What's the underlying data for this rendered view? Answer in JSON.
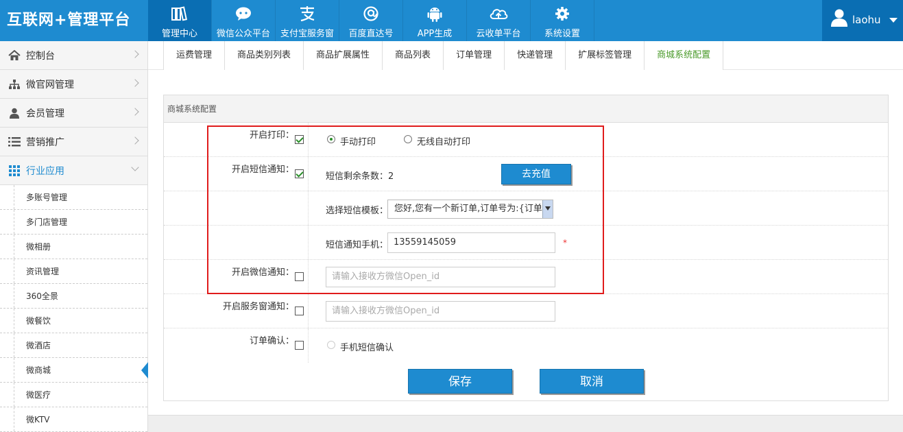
{
  "app": {
    "logo": "互联网+管理平台"
  },
  "topnav": [
    {
      "label": "管理中心",
      "icon": "books-icon",
      "active": true
    },
    {
      "label": "微信公众平台",
      "icon": "chat-bubble-icon",
      "active": false
    },
    {
      "label": "支付宝服务窗",
      "icon": "alipay-icon",
      "active": false
    },
    {
      "label": "百度直达号",
      "icon": "at-sign-icon",
      "active": false
    },
    {
      "label": "APP生成",
      "icon": "android-icon",
      "active": false
    },
    {
      "label": "云收单平台",
      "icon": "cloud-upload-icon",
      "active": false
    },
    {
      "label": "系统设置",
      "icon": "gear-icon",
      "active": false
    }
  ],
  "user": {
    "name": "laohu",
    "icon": "user-icon"
  },
  "sidebar": {
    "items": [
      {
        "label": "控制台",
        "icon": "home-icon"
      },
      {
        "label": "微官网管理",
        "icon": "sitemap-icon"
      },
      {
        "label": "会员管理",
        "icon": "user-icon"
      },
      {
        "label": "营销推广",
        "icon": "list-icon"
      },
      {
        "label": "行业应用",
        "icon": "grid-icon",
        "open": true
      }
    ],
    "subitems": [
      {
        "label": "多账号管理"
      },
      {
        "label": "多门店管理"
      },
      {
        "label": "微相册"
      },
      {
        "label": "资讯管理"
      },
      {
        "label": "360全景"
      },
      {
        "label": "微餐饮"
      },
      {
        "label": "微酒店"
      },
      {
        "label": "微商城",
        "active": true
      },
      {
        "label": "微医疗"
      },
      {
        "label": "微KTV"
      }
    ]
  },
  "subtabs": [
    {
      "label": "运费管理"
    },
    {
      "label": "商品类别列表"
    },
    {
      "label": "商品扩展属性"
    },
    {
      "label": "商品列表"
    },
    {
      "label": "订单管理"
    },
    {
      "label": "快递管理"
    },
    {
      "label": "扩展标签管理"
    },
    {
      "label": "商城系统配置",
      "active": true
    }
  ],
  "panel": {
    "title": "商城系统配置",
    "print": {
      "label": "开启打印：",
      "checked": true,
      "options": [
        "手动打印",
        "无线自动打印"
      ],
      "selected": "手动打印"
    },
    "sms": {
      "label": "开启短信通知：",
      "checked": true,
      "remaining_label": "短信剩余条数：2",
      "recharge_button": "去充值"
    },
    "sms_template": {
      "label": "选择短信模板：",
      "value": "您好,您有一个新订单,订单号为:{订单号}"
    },
    "sms_phone": {
      "label": "短信通知手机：",
      "value": "13559145059",
      "required_mark": "*"
    },
    "wechat": {
      "label": "开启微信通知：",
      "checked": false,
      "placeholder": "请输入接收方微信Open_id"
    },
    "service_window": {
      "label": "开启服务窗通知：",
      "checked": false,
      "placeholder": "请输入接收方微信Open_id"
    },
    "order_confirm": {
      "label": "订单确认：",
      "checked": false,
      "option": "手机短信确认"
    }
  },
  "actions": {
    "save": "保存",
    "cancel": "取消"
  },
  "colors": {
    "brand": "#1e8bd0",
    "brand_dark": "#0a6eb3",
    "highlight": "#e01b1b",
    "active_tab": "#4a9a2a"
  }
}
